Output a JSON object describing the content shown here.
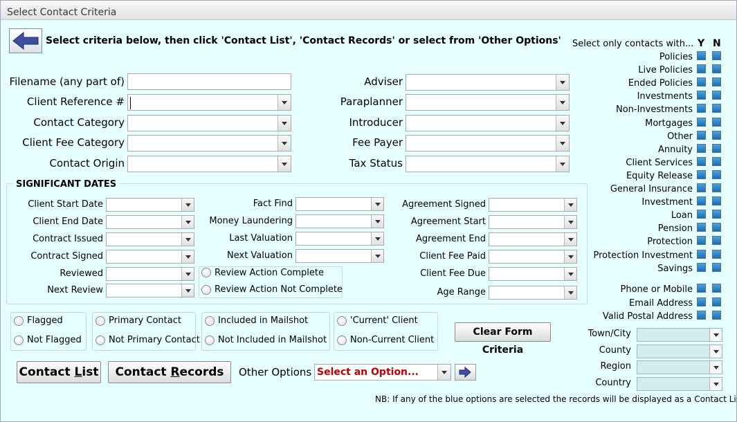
{
  "window": {
    "title": "Select Contact Criteria"
  },
  "instruction": "Select criteria below, then click 'Contact List', 'Contact Records' or select from 'Other Options'",
  "fields_left": [
    {
      "label": "Filename (any part of)"
    },
    {
      "label": "Client Reference #"
    },
    {
      "label": "Contact Category"
    },
    {
      "label": "Client Fee Category"
    },
    {
      "label": "Contact Origin"
    }
  ],
  "fields_right": [
    {
      "label": "Adviser"
    },
    {
      "label": "Paraplanner"
    },
    {
      "label": "Introducer"
    },
    {
      "label": "Fee Payer"
    },
    {
      "label": "Tax Status"
    }
  ],
  "dates": {
    "title": "SIGNIFICANT DATES",
    "col1": [
      "Client Start Date",
      "Client End Date",
      "Contract Issued",
      "Contract Signed",
      "Reviewed",
      "Next Review"
    ],
    "col2": [
      "Fact Find",
      "Money Laundering",
      "Last Valuation",
      "Next Valuation"
    ],
    "col3": [
      "Agreement Signed",
      "Agreement Start",
      "Agreement End",
      "Client Fee Paid",
      "Client Fee Due",
      "Age Range"
    ],
    "review_options": [
      "Review Action Complete",
      "Review Action Not Complete"
    ]
  },
  "flag_groups": [
    [
      "Flagged",
      "Not Flagged"
    ],
    [
      "Primary Contact",
      "Not Primary Contact"
    ],
    [
      "Included in Mailshot",
      "Not Included in Mailshot"
    ],
    [
      "'Current' Client",
      "Non-Current Client"
    ]
  ],
  "buttons": {
    "clear": "Clear Form Criteria",
    "contact_list_pre": "Contact ",
    "contact_list_key": "L",
    "contact_list_post": "ist",
    "contact_records_pre": "Contact ",
    "contact_records_key": "R",
    "contact_records_post": "ecords"
  },
  "other_options": {
    "label": "Other Options",
    "value": "Select an Option...",
    "value_color": "#c00000"
  },
  "right_panel": {
    "header": "Select only contacts with...",
    "y": "Y",
    "n": "N",
    "items": [
      "Policies",
      "Live Policies",
      "Ended Policies",
      "Investments",
      "Non-Investments",
      "Mortgages",
      "Other",
      "Annuity",
      "Client Services",
      "Equity Release",
      "General Insurance",
      "Investment",
      "Loan",
      "Pension",
      "Protection",
      "Protection Investment",
      "Savings"
    ],
    "contact_items": [
      "Phone or Mobile",
      "Email Address",
      "Valid Postal Address"
    ],
    "location": [
      "Town/City",
      "County",
      "Region",
      "Country"
    ],
    "checkbox_color": "#1a6eb5"
  },
  "note": "NB: If any of the blue options are selected the records will be displayed as a Contact List"
}
